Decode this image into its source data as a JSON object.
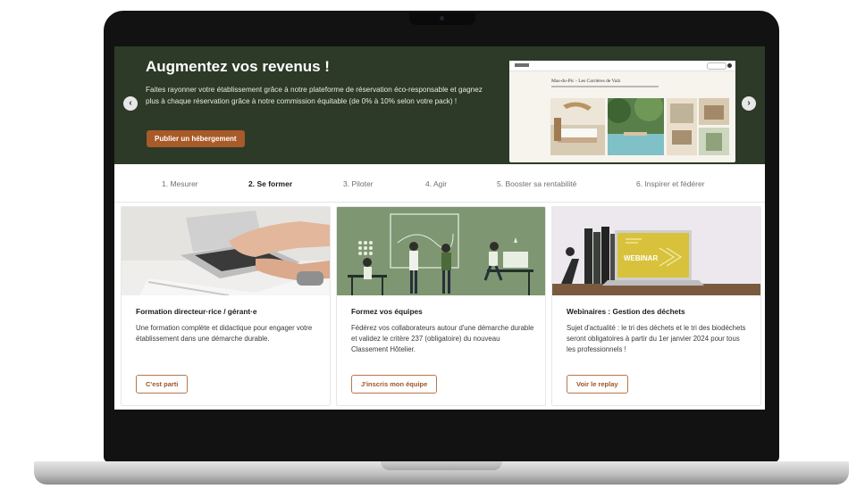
{
  "hero": {
    "title": "Augmentez vos revenus !",
    "description": "Faites rayonner votre établissement grâce à notre plateforme de réservation éco-responsable et gagnez plus à chaque réservation grâce à notre commission équitable (de 0% à 10% selon votre pack) !",
    "cta_label": "Publier un hébergement",
    "prev_icon": "chevron-left-icon",
    "next_icon": "chevron-right-icon",
    "preview_title": "Mas-du-Pic - Les Carrières de Valz"
  },
  "tabs": [
    {
      "label": "1. Mesurer"
    },
    {
      "label": "2. Se former"
    },
    {
      "label": "3. Piloter"
    },
    {
      "label": "4. Agir"
    },
    {
      "label": "5. Booster sa rentabilité"
    },
    {
      "label": "6. Inspirer et fédérer"
    }
  ],
  "active_tab": "2. Se former",
  "cards": [
    {
      "title": "Formation directeur·rice / gérant·e",
      "description": "Une formation complète et didactique pour engager votre établissement dans une démarche durable.",
      "button": "C'est parti"
    },
    {
      "title": "Formez vos équipes",
      "description": "Fédérez vos collaborateurs autour d'une démarche durable et validez le critère 237 (obligatoire) du nouveau Classement Hôtelier.",
      "button": "J'inscris mon équipe"
    },
    {
      "title": "Webinaires : Gestion des déchets",
      "description": "Sujet d'actualité : le tri des déchets et le tri des biodéchets seront obligatoires à partir du 1er janvier 2024 pour tous les professionnels !",
      "button": "Voir le replay",
      "image_text": "WEBINAR"
    }
  ],
  "colors": {
    "hero_bg": "#2c3a27",
    "accent": "#a85a28",
    "illustration_bg": "#7f9672"
  }
}
